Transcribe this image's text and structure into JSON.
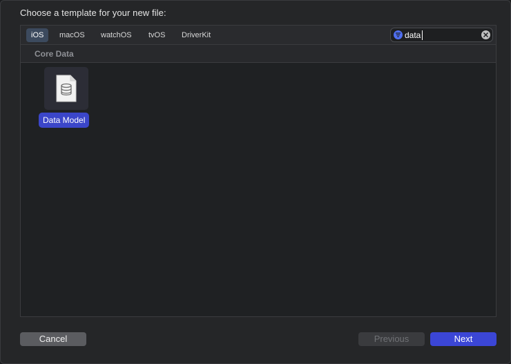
{
  "dialog": {
    "title": "Choose a template for your new file:"
  },
  "platform_tabs": [
    {
      "label": "iOS",
      "selected": true
    },
    {
      "label": "macOS",
      "selected": false
    },
    {
      "label": "watchOS",
      "selected": false
    },
    {
      "label": "tvOS",
      "selected": false
    },
    {
      "label": "DriverKit",
      "selected": false
    }
  ],
  "search": {
    "value": "data",
    "icon": "filter-icon",
    "clear_icon": "clear-icon"
  },
  "sections": [
    {
      "label": "Core Data",
      "templates": [
        {
          "label": "Data Model",
          "icon": "database-document-icon",
          "selected": true
        }
      ]
    }
  ],
  "buttons": {
    "cancel": "Cancel",
    "previous": "Previous",
    "next": "Next"
  },
  "colors": {
    "accent": "#3b46d6",
    "selection": "#3b46c9",
    "tab_selected": "#3c4a5e"
  }
}
